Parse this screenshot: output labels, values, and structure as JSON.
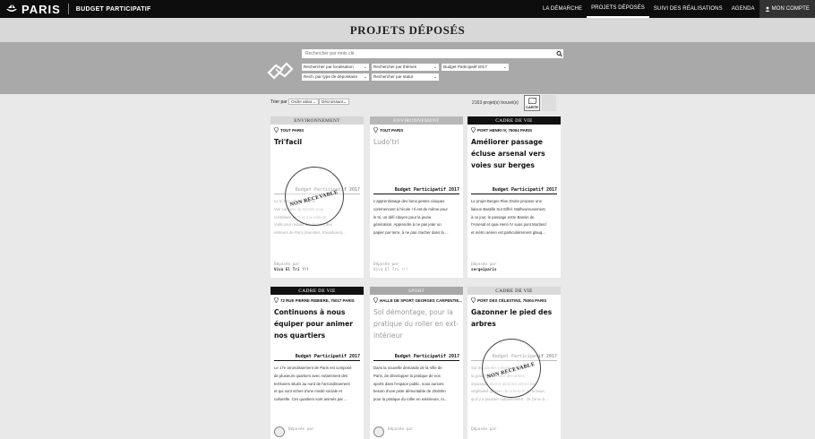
{
  "header": {
    "logo_text": "PARIS",
    "site_name": "BUDGET PARTICIPATIF",
    "nav": [
      {
        "label": "LA DÉMARCHE"
      },
      {
        "label": "PROJETS DÉPOSÉS"
      },
      {
        "label": "SUIVI DES RÉALISATIONS"
      },
      {
        "label": "AGENDA"
      },
      {
        "label": "MON COMPTE"
      }
    ]
  },
  "page_title": "PROJETS DÉPOSÉS",
  "search": {
    "placeholder": "Rechercher par mots clé",
    "filters": [
      {
        "label": "Rechercher par localisation"
      },
      {
        "label": "Rechercher par thèmes"
      },
      {
        "label": "Budget Participatif 2017"
      },
      {
        "label": "Rech. par type de dépositaire"
      },
      {
        "label": "Rechercher par statut"
      }
    ]
  },
  "sort": {
    "label": "Trier par :",
    "order": "Ordre aléat.",
    "direction": "Décroissant",
    "count": "2163 projet(s) trouvé(s)",
    "map_button": "CARTE"
  },
  "cards": [
    {
      "category": "ENVIRONNEMENT",
      "location": "TOUT PARIS",
      "title": "Tri'facil",
      "budget": "Budget Participatif 2017",
      "description": [
        "Le tri sélectif, c'est facile",
        "Voir conseils du Syctom pour",
        "contribuer au tri et à la collecte",
        "Voilà pour réduire les déchets des",
        "visiteurs de Paris (touristes, travailleurs)..."
      ],
      "deposed_label": "Déposée par",
      "deposed_by": "Viva El Tri !!!",
      "stamp": "NON RECEVABLE"
    },
    {
      "category": "ENVIRONNEMENT",
      "location": "TOUT PARIS",
      "title": "Ludo'tri",
      "budget": "Budget Participatif 2017",
      "description": [
        "L'apprentissage des bons gestes civiques",
        "commencent à l'école ! Il est de même pour",
        "le tri, un défi citoyen pour la jeune",
        "génération. Apprendre à ne pas jeter un",
        "papier par terre, à ne pas cracher dans la ..."
      ],
      "deposed_label": "Déposée par",
      "deposed_by": "Viva El Tri !!!"
    },
    {
      "category": "CADRE DE VIE",
      "location": "PORT HENRI IV, 75004 PARIS",
      "title": "Améliorer passage écluse arsenal vers voies sur berges",
      "budget": "Budget Participatif 2017",
      "description": [
        "Le projet Berges Rive Droite propose une",
        "liaison Bastille Sur Eiffel. Malheureusement,",
        "à ce jour, le passage entre Bassin de",
        "l'Arsenal et quai Henri IV sous pont Morland",
        "et métro aérien est particulièrement glauq..."
      ],
      "deposed_label": "Déposée par",
      "deposed_by": "serge1paris"
    },
    {
      "category": "CADRE DE VIE",
      "location": "72 RUE PIERRE REBIÈRE, 75017 PARIS",
      "title": "Continuons à nous équiper pour animer nos quartiers",
      "budget": "Budget Participatif 2017",
      "description": [
        "Le 17e arrondissement de Paris est composé",
        "de plusieurs quartiers avec notamment des",
        "territoires situés au nord de l'arrondissement",
        "et qui sont riches d'une mixité sociale et",
        "culturelle. Ces quartiers sont animés par ..."
      ],
      "deposed_label": "Déposée par",
      "deposed_by": ""
    },
    {
      "category": "SPORT",
      "location": "HALLE DE SPORT GEORGES CARPENTIE...",
      "title": "Sol démontage, pour la pratique du roller en ext-intérieur",
      "budget": "Budget Participatif 2017",
      "description": [
        "Dans la nouvelle demande de la Ville de",
        "Paris, de développer la pratique de nos",
        "sports dans l'espace public, nous aurions",
        "besoin d'une piste démontable de 20x50m",
        "pour la pratique du roller en extérieure, m..."
      ],
      "deposed_label": "Déposée par",
      "deposed_by": ""
    },
    {
      "category": "CADRE DE VIE",
      "location": "PORT DES CÉLESTINS, 75004 PARIS",
      "title": "Gazonner le pied des arbres",
      "budget": "Budget Participatif 2017",
      "description": [
        "Sur le quai des Célestins, il y a",
        "la grande allée avec des arbres",
        "imposants dont le pied des arbres est",
        "végétalisé qu'avec de la terre et de la boue,",
        "qu'il y a pousser naturellement . Or j'ai vu à ..."
      ],
      "deposed_label": "Déposée par",
      "deposed_by": "",
      "stamp": "NON RECEVABLE"
    }
  ]
}
